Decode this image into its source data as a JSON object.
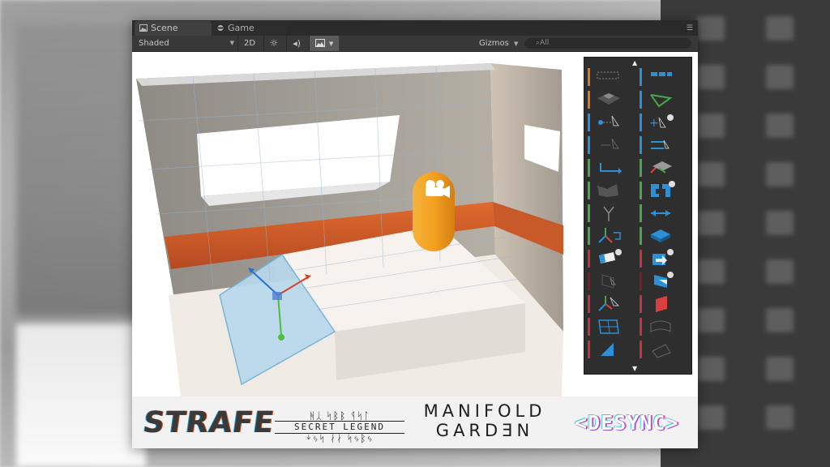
{
  "window": {
    "tabs": [
      {
        "label": "Scene",
        "icon": "scene-icon",
        "active": true
      },
      {
        "label": "Game",
        "icon": "game-icon",
        "active": false
      }
    ]
  },
  "toolbar": {
    "shading_mode": "Shaded",
    "mode_2d_label": "2D",
    "lighting_icon": "sun-icon",
    "audio_icon": "speaker-icon",
    "effects_icon": "image-icon",
    "gizmos_label": "Gizmos",
    "search_placeholder": "⌕All"
  },
  "palette": {
    "up_arrow": "▲",
    "down_arrow": "▼",
    "accent_colors": {
      "orange": "#d9772a",
      "blue": "#2d8fd5",
      "green": "#4aa64a",
      "red": "#c8323c",
      "dark_red": "#7a1f27"
    }
  },
  "logos": {
    "strafe": "STRAFE",
    "secret_legend_glyphs_top": "ᚻᛸ ᛋᛒᛒ ᛩᛋᛚ",
    "secret_legend": "SECRET LEGEND",
    "secret_legend_glyphs_bottom": "ᛎᛃᛋ ᛅᛅ ᛋᛃᛒᛃ",
    "manifold_line1": "MANIFOLD",
    "manifold_line2": "GARDƎN",
    "desync": "<DESYNC>"
  },
  "colors": {
    "editor_dark": "#383838",
    "tab_active": "#404040",
    "capsule": "#f0a12a",
    "stripe": "#d9652b"
  }
}
